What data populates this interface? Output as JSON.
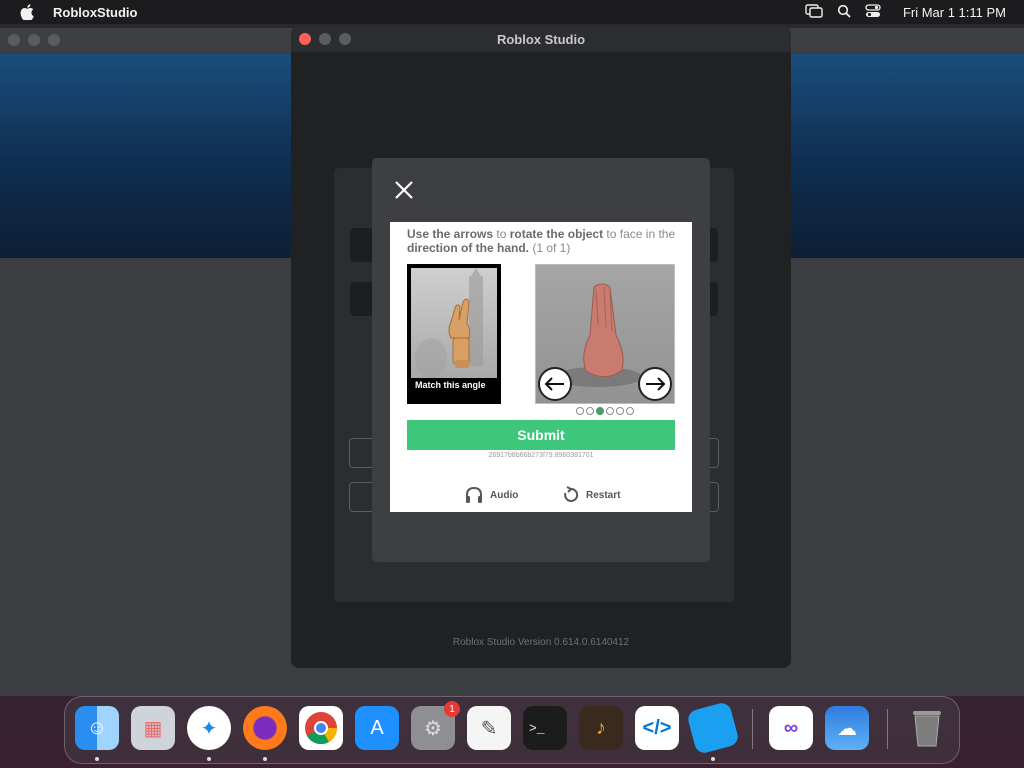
{
  "menubar": {
    "app_name": "RobloxStudio",
    "clock": "Fri Mar 1  1:11 PM"
  },
  "window": {
    "title": "Roblox Studio",
    "version": "Roblox Studio Version 0.614.0.6140412"
  },
  "captcha": {
    "instruction_parts": [
      "Use the arrows",
      " to ",
      "rotate the object",
      " to face in the ",
      "direction of the hand.",
      " (1 of 1)"
    ],
    "reference_caption": "Match this angle",
    "submit_label": "Submit",
    "session_id": "26917b8b66b273f79.8960381701",
    "audio_label": "Audio",
    "restart_label": "Restart",
    "dots": [
      false,
      false,
      true,
      false,
      false,
      false
    ]
  },
  "dock": {
    "items": [
      "Finder",
      "Launchpad",
      "Safari",
      "Firefox",
      "Chrome",
      "App Store",
      "System Settings",
      "TextEdit",
      "Terminal",
      "GarageBand",
      "Visual Studio Code",
      "Roblox Studio",
      "Visual Studio",
      "Weather",
      "Trash"
    ],
    "settings_badge": "1"
  },
  "colors": {
    "submit": "#3ec77a",
    "active_dot": "#4a9a68"
  }
}
